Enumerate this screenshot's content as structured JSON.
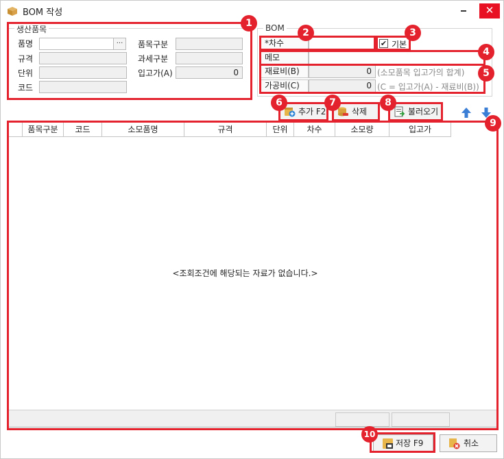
{
  "window": {
    "title": "BOM 작성",
    "close_symbol": "✕"
  },
  "production_group": {
    "title": "생산품목",
    "fields": {
      "item_name": {
        "label": "품명",
        "value": ""
      },
      "spec": {
        "label": "규격",
        "value": ""
      },
      "unit": {
        "label": "단위",
        "value": ""
      },
      "code": {
        "label": "코드",
        "value": ""
      },
      "item_type": {
        "label": "품목구분",
        "value": ""
      },
      "tax_type": {
        "label": "과세구분",
        "value": ""
      },
      "receiving_price": {
        "label": "입고가(A)",
        "value": "0"
      }
    },
    "lookup_button": "···"
  },
  "bom_group": {
    "title": "BOM",
    "revision_label": "*차수",
    "revision_value": "",
    "default_label": "기본",
    "default_checked": true,
    "memo_label": "메모",
    "memo_value": "",
    "material_cost_label": "재료비(B)",
    "material_cost_value": "0",
    "material_cost_hint": "(소모품목 입고가의 합계)",
    "processing_cost_label": "가공비(C)",
    "processing_cost_value": "0",
    "processing_cost_hint": "(C = 입고가(A) - 재료비(B))"
  },
  "toolbar": {
    "add_label": "추가 F2",
    "delete_label": "삭제",
    "load_label": "불러오기"
  },
  "grid": {
    "columns": [
      "품목구분",
      "코드",
      "소모품명",
      "규격",
      "단위",
      "차수",
      "소모량",
      "입고가"
    ],
    "empty_message": "<조회조건에 해당되는 자료가 없습니다.>"
  },
  "footer": {
    "save_label": "저장 F9",
    "cancel_label": "취소"
  },
  "annotations": [
    "1",
    "2",
    "3",
    "4",
    "5",
    "6",
    "7",
    "8",
    "9",
    "10"
  ],
  "colors": {
    "annotation_red": "#e4222d",
    "arrow_blue": "#3a7fd5"
  }
}
